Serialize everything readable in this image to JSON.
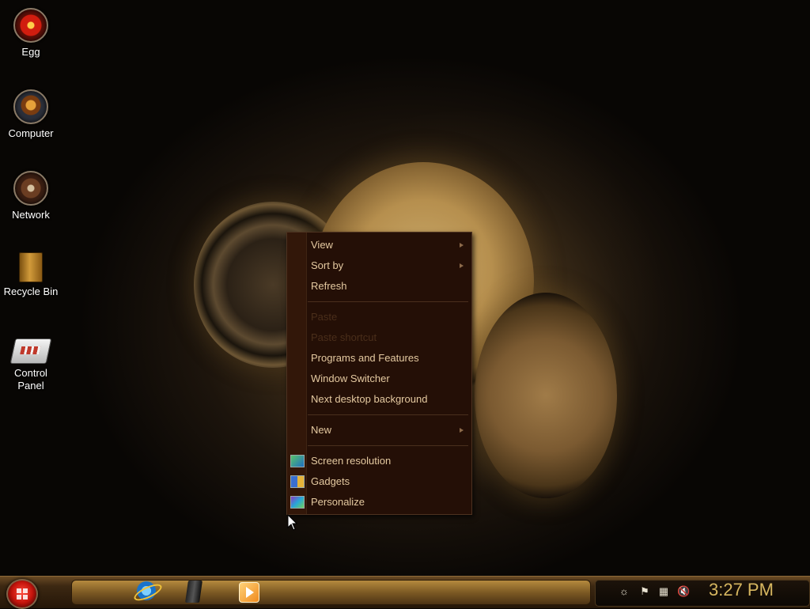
{
  "desktop": {
    "icons": [
      {
        "label": "Egg",
        "icon": "egg-orb-icon"
      },
      {
        "label": "Computer",
        "icon": "computer-orb-icon"
      },
      {
        "label": "Network",
        "icon": "network-orb-icon"
      },
      {
        "label": "Recycle Bin",
        "icon": "recycle-bin-icon"
      },
      {
        "label": "Control Panel",
        "icon": "control-panel-icon"
      }
    ]
  },
  "context_menu": {
    "items": [
      {
        "label": "View",
        "has_submenu": true,
        "enabled": true
      },
      {
        "label": "Sort by",
        "has_submenu": true,
        "enabled": true
      },
      {
        "label": "Refresh",
        "has_submenu": false,
        "enabled": true
      },
      {
        "label": "Paste",
        "has_submenu": false,
        "enabled": false
      },
      {
        "label": "Paste shortcut",
        "has_submenu": false,
        "enabled": false
      },
      {
        "label": "Programs and Features",
        "has_submenu": false,
        "enabled": true
      },
      {
        "label": "Window Switcher",
        "has_submenu": false,
        "enabled": true
      },
      {
        "label": "Next desktop background",
        "has_submenu": false,
        "enabled": true
      },
      {
        "label": "New",
        "has_submenu": true,
        "enabled": true
      },
      {
        "label": "Screen resolution",
        "icon": "screen-resolution-icon",
        "enabled": true
      },
      {
        "label": "Gadgets",
        "icon": "gadgets-icon",
        "enabled": true
      },
      {
        "label": "Personalize",
        "icon": "personalize-icon",
        "enabled": true
      }
    ]
  },
  "taskbar": {
    "start_icon": "windows-start-orb-icon",
    "pinned": [
      {
        "name": "Internet Explorer",
        "icon": "internet-explorer-icon"
      },
      {
        "name": "Windows Explorer",
        "icon": "explorer-icon"
      },
      {
        "name": "Windows Media Player",
        "icon": "media-player-icon"
      }
    ],
    "tray_icons": [
      "settings-gear-icon",
      "action-center-flag-icon",
      "network-icon",
      "volume-muted-icon"
    ],
    "clock": "3:27 PM"
  },
  "colors": {
    "menu_bg": "#240f06",
    "menu_text": "#e4c9a0",
    "menu_text_disabled": "#4a2e1a",
    "clock_text": "#d7b760"
  }
}
